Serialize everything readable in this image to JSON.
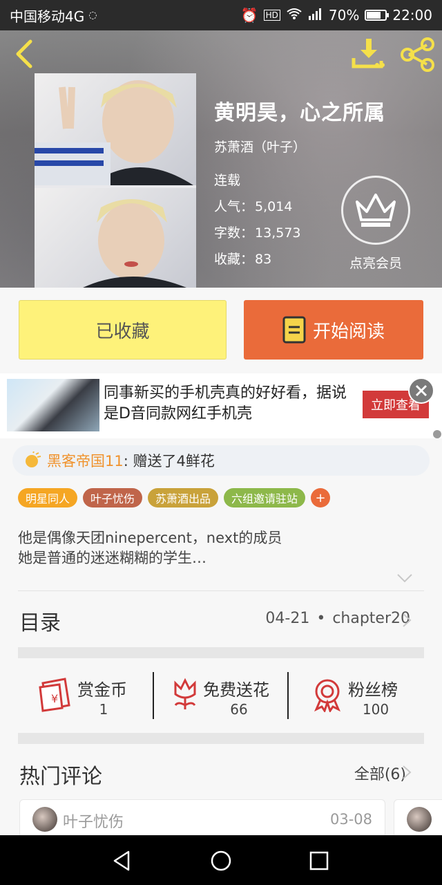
{
  "status_bar": {
    "carrier": "中国移动4G",
    "battery": "70%",
    "time": "22:00"
  },
  "book": {
    "title": "黄明昊，心之所属",
    "author": "苏萧酒（叶子）",
    "status": "连载",
    "popularity_label": "人气：",
    "popularity": "5,014",
    "words_label": "字数：",
    "words": "13,573",
    "favorites_label": "收藏：",
    "favorites": "83",
    "vip_label": "点亮会员"
  },
  "actions": {
    "collected_label": "已收藏",
    "read_label": "开始阅读"
  },
  "ad": {
    "text": "同事新买的手机壳真的好好看，据说是D音同款网红手机壳",
    "button": "立即查看"
  },
  "gift": {
    "user": "黑客帝国11",
    "message": ": 赠送了4鲜花"
  },
  "tags": [
    {
      "label": "明星同人",
      "color": "#f5a623"
    },
    {
      "label": "叶子忧伤",
      "color": "#c0654a"
    },
    {
      "label": "苏萧酒出品",
      "color": "#c9a23a"
    },
    {
      "label": "六组邀请驻站",
      "color": "#8db84a"
    }
  ],
  "tag_add": "+",
  "description": {
    "line1": "他是偶像天团ninepercent，next的成员",
    "line2": "她是普通的迷迷糊糊的学生…"
  },
  "catalog": {
    "title": "目录",
    "date": "04-21",
    "dot": "•",
    "chapter": "chapter20"
  },
  "stats": [
    {
      "label": "赏金币",
      "value": "1",
      "icon": "red-envelope-icon"
    },
    {
      "label": "免费送花",
      "value": "66",
      "icon": "flower-icon"
    },
    {
      "label": "粉丝榜",
      "value": "100",
      "icon": "medal-icon"
    }
  ],
  "comments": {
    "title": "热门评论",
    "all_label": "全部(6)",
    "first_user": "叶子忧伤",
    "first_date": "03-08"
  },
  "colors": {
    "accent_orange": "#ea6b3a",
    "collected_yellow": "#fef27a",
    "icon_red": "#d23a3a",
    "header_icon_yellow": "#f5e04a"
  }
}
